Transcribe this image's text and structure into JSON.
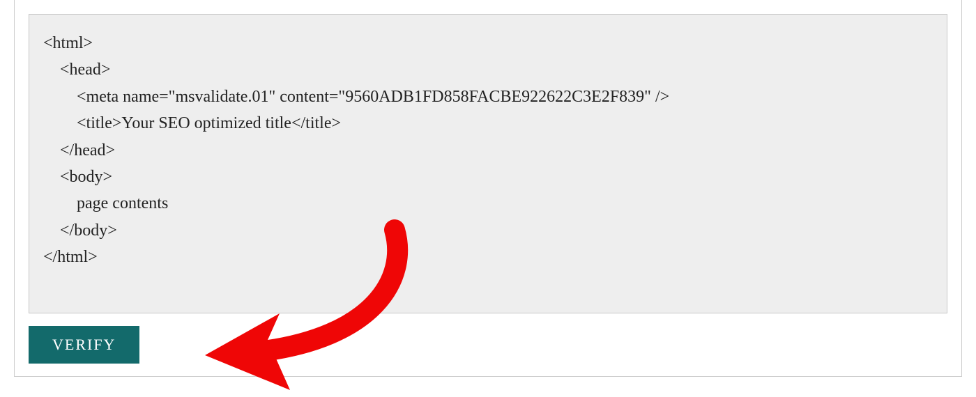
{
  "code": {
    "line1": "<html>",
    "line2": "    <head>",
    "line3": "        <meta name=\"msvalidate.01\" content=\"9560ADB1FD858FACBE922622C3E2F839\" />",
    "line4": "        <title>Your SEO optimized title</title>",
    "line5": "    </head>",
    "line6": "    <body>",
    "line7": "        page contents",
    "line8": "    </body>",
    "line9": "</html>"
  },
  "button": {
    "verify_label": "VERIFY"
  },
  "colors": {
    "button_bg": "#136a6b",
    "annotation": "#ef0606"
  }
}
